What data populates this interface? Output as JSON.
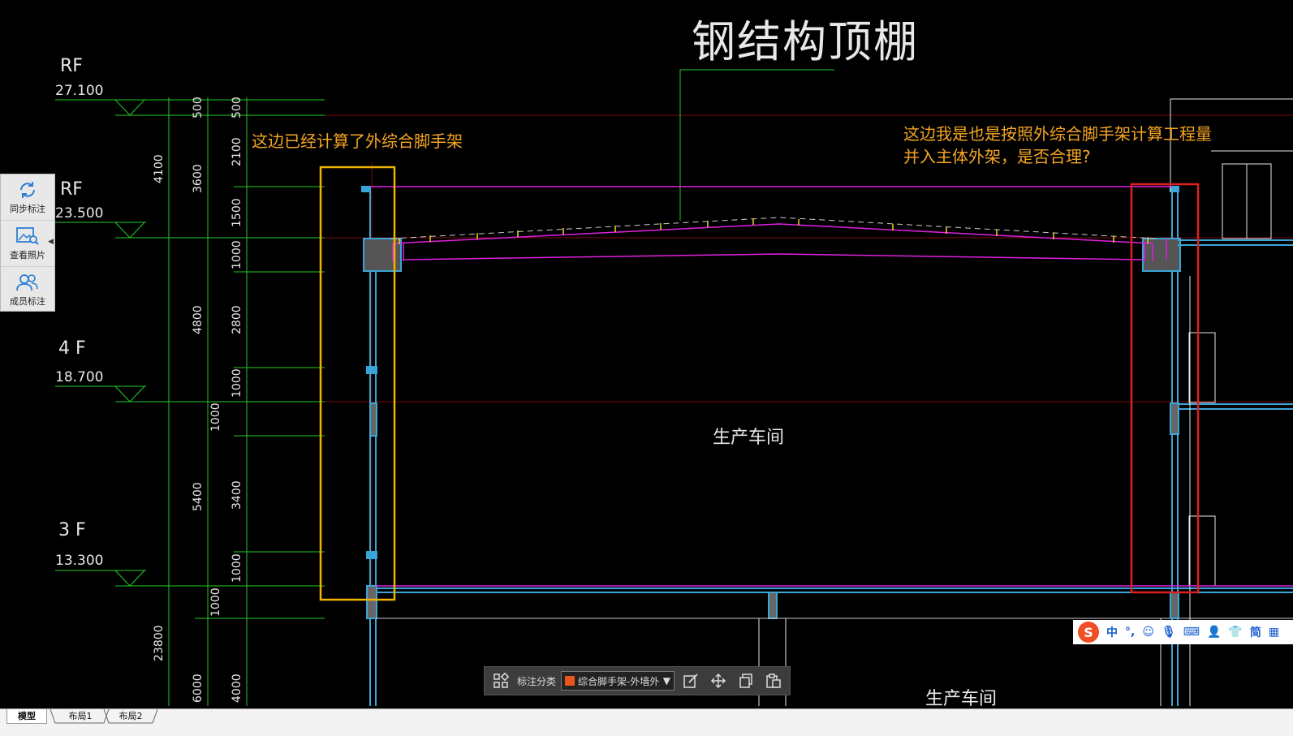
{
  "drawing": {
    "title": "钢结构顶棚",
    "room_label": "生产车间",
    "room_label_lower": "生产车间",
    "levels": [
      {
        "name": "RF",
        "elevation": "27.100"
      },
      {
        "name": "RF",
        "elevation": "23.500"
      },
      {
        "name": "4 F",
        "elevation": "18.700"
      },
      {
        "name": "3 F",
        "elevation": "13.300"
      }
    ],
    "dims_col1": [
      "4100",
      "4800",
      "5400",
      "23800"
    ],
    "dims_col2": [
      "500",
      "3600",
      "1000",
      "1000",
      "6000"
    ],
    "dims_col3": [
      "500",
      "2100",
      "1500",
      "1000",
      "2800",
      "1000",
      "3400",
      "1000",
      "4000"
    ]
  },
  "notes": {
    "left": "这边已经计算了外综合脚手架",
    "right_line1": "这边我是也是按照外综合脚手架计算工程量",
    "right_line2": "并入主体外架，是否合理?"
  },
  "side_panel": {
    "sync": "同步标注",
    "photos": "查看照片",
    "members": "成员标注"
  },
  "toolbar": {
    "category_label": "标注分类",
    "category_value": "综合脚手架-外墙外边",
    "category_color": "#e8561e"
  },
  "ime": {
    "cn": "中",
    "punct": "°,",
    "simp": "简"
  },
  "tabs": {
    "model": "模型",
    "layout1": "布局1",
    "layout2": "布局2"
  },
  "colors": {
    "dim_green": "#22cc22",
    "wall_cyan": "#3aa6d8",
    "roof_magenta": "#e020e0",
    "note_orange": "#f5a623",
    "box_yellow": "#f0b400",
    "box_red": "#e02020"
  }
}
